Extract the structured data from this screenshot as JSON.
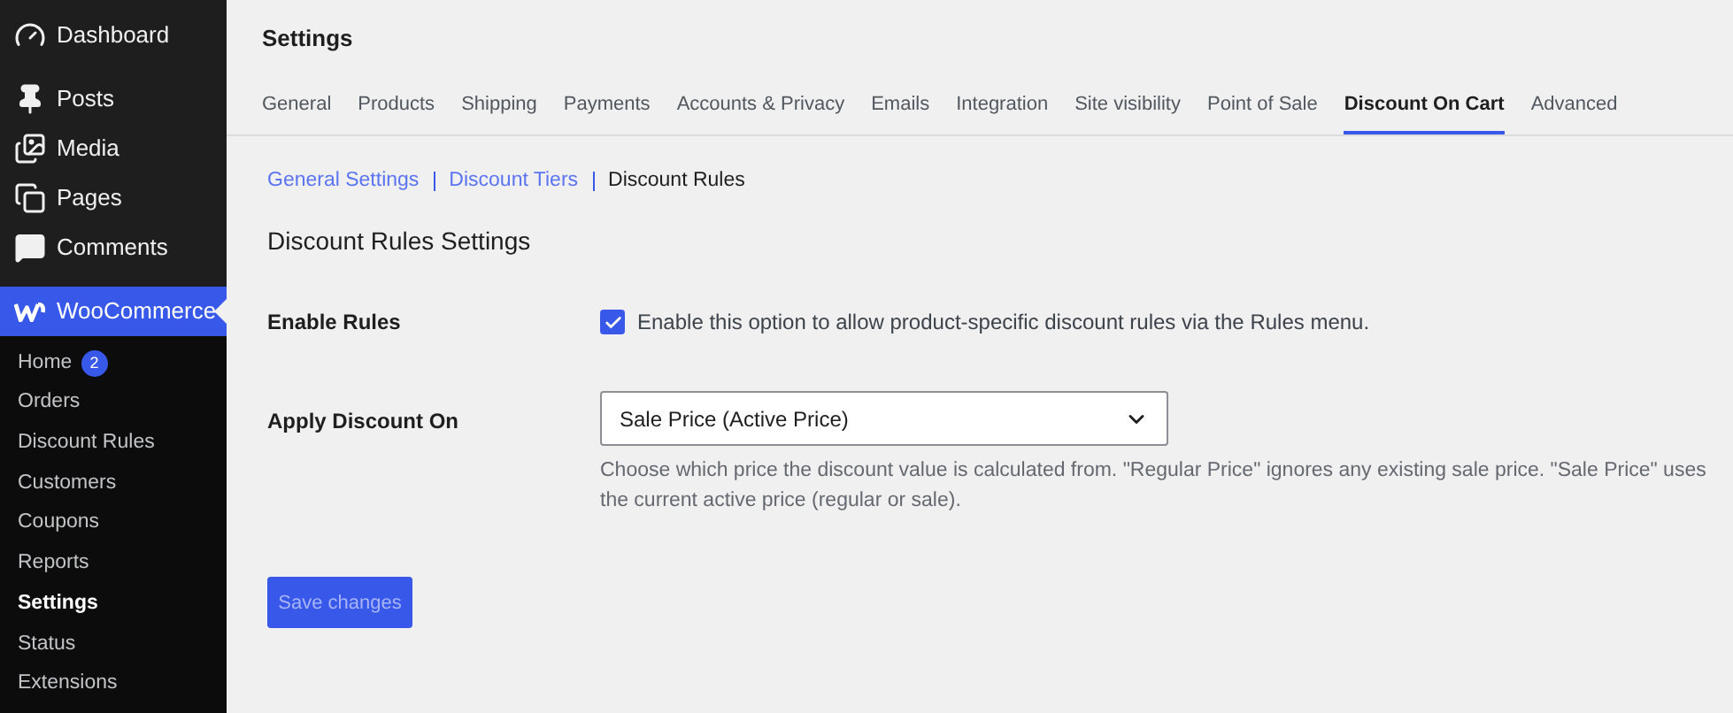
{
  "sidebar": {
    "menu": [
      {
        "kind": "dashboard",
        "label": "Dashboard",
        "selected": false
      },
      {
        "kind": "pin",
        "label": "Posts",
        "selected": false
      },
      {
        "kind": "media",
        "label": "Media",
        "selected": false
      },
      {
        "kind": "pages",
        "label": "Pages",
        "selected": false
      },
      {
        "kind": "comment",
        "label": "Comments",
        "selected": false
      },
      {
        "kind": "woo",
        "label": "WooCommerce",
        "selected": true
      }
    ],
    "submenu": [
      {
        "label": "Home",
        "badge": "2",
        "selected": false
      },
      {
        "label": "Orders",
        "selected": false
      },
      {
        "label": "Discount Rules",
        "selected": false
      },
      {
        "label": "Customers",
        "selected": false
      },
      {
        "label": "Coupons",
        "selected": false
      },
      {
        "label": "Reports",
        "selected": false
      },
      {
        "label": "Settings",
        "selected": true
      },
      {
        "label": "Status",
        "selected": false
      },
      {
        "label": "Extensions",
        "selected": false
      }
    ]
  },
  "page_title": "Settings",
  "tabs": [
    {
      "label": "General",
      "selected": false
    },
    {
      "label": "Products",
      "selected": false
    },
    {
      "label": "Shipping",
      "selected": false
    },
    {
      "label": "Payments",
      "selected": false
    },
    {
      "label": "Accounts & Privacy",
      "selected": false
    },
    {
      "label": "Emails",
      "selected": false
    },
    {
      "label": "Integration",
      "selected": false
    },
    {
      "label": "Site visibility",
      "selected": false
    },
    {
      "label": "Point of Sale",
      "selected": false
    },
    {
      "label": "Discount On Cart",
      "selected": true
    },
    {
      "label": "Advanced",
      "selected": false
    }
  ],
  "subnav": [
    {
      "label": "General Settings",
      "selected": false
    },
    {
      "label": "Discount Tiers",
      "selected": false
    },
    {
      "label": "Discount Rules",
      "selected": true
    }
  ],
  "section_title": "Discount Rules Settings",
  "fields": [
    {
      "kind": "checkbox",
      "label": "Enable Rules",
      "checked": true,
      "text": "Enable this option to allow product-specific discount rules via the Rules menu."
    },
    {
      "kind": "select",
      "label": "Apply Discount On",
      "value": "Sale Price (Active Price)",
      "help": "Choose which price the discount value is calculated from. \"Regular Price\" ignores any existing sale price. \"Sale Price\" uses the current active price (regular or sale)."
    }
  ],
  "save_button": {
    "label": "Save changes",
    "disabled": true
  }
}
